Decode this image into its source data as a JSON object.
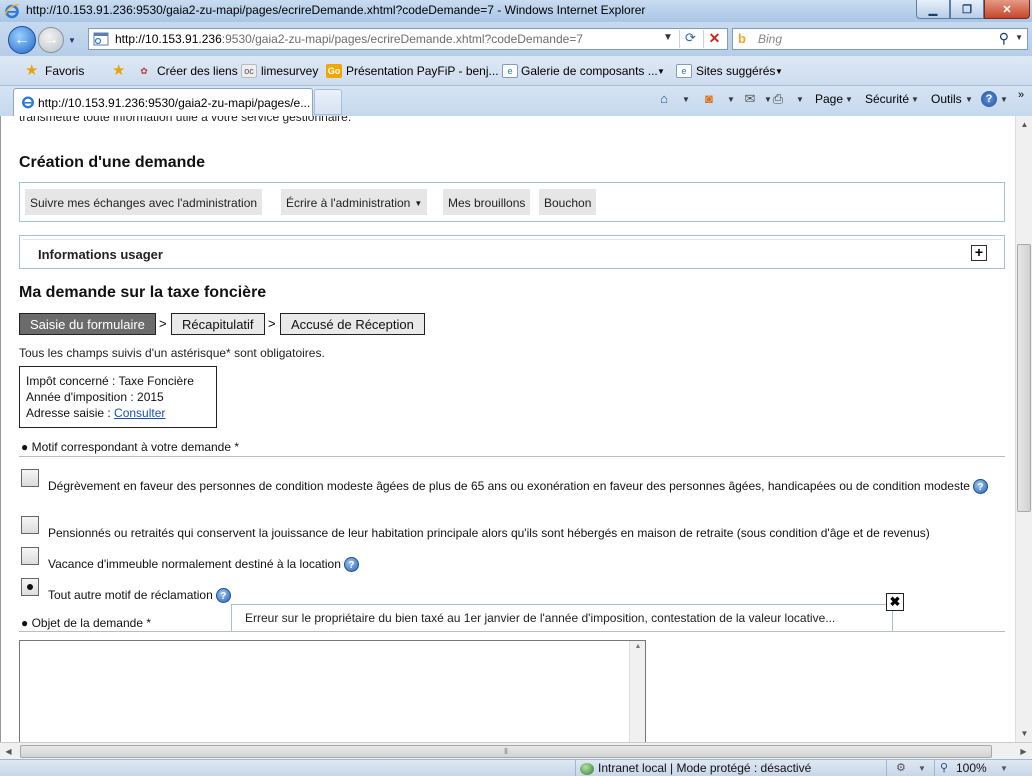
{
  "window": {
    "title": "http://10.153.91.236:9530/gaia2-zu-mapi/pages/ecrireDemande.xhtml?codeDemande=7 - Windows Internet Explorer",
    "controls": [
      "minimize",
      "maximize",
      "close"
    ]
  },
  "address": {
    "url_host": "http://10.153.91.236",
    "url_rest": ":9530/gaia2-zu-mapi/pages/ecrireDemande.xhtml?codeDemande=7",
    "search_placeholder": "Bing"
  },
  "favorites": {
    "label": "Favoris",
    "links": [
      {
        "label": "Créer des liens",
        "icon": "link-icon"
      },
      {
        "label": "limesurvey",
        "icon": "limesurvey-icon"
      },
      {
        "label": "Présentation PayFiP - benj...",
        "icon": "payfip-icon"
      },
      {
        "label": "Galerie de composants ...",
        "icon": "gallery-icon"
      },
      {
        "label": "Sites suggérés",
        "icon": "suggested-sites-icon"
      }
    ]
  },
  "tab": {
    "label": "http://10.153.91.236:9530/gaia2-zu-mapi/pages/e..."
  },
  "commandbar": {
    "page": "Page",
    "security": "Sécurité",
    "tools": "Outils"
  },
  "page": {
    "cut_text": "transmettre toute information utile à votre service gestionnaire.",
    "title": "Création d'une demande",
    "menu": {
      "follow": "Suivre mes échanges avec l'administration",
      "write": "Écrire à l'administration",
      "drafts": "Mes brouillons",
      "stub": "Bouchon"
    },
    "info_panel": {
      "label": "Informations usager",
      "toggle": "+"
    },
    "section_title": "Ma demande sur la taxe foncière",
    "steps": [
      "Saisie du formulaire",
      "Récapitulatif",
      "Accusé de Réception"
    ],
    "step_separator": ">",
    "required_note": "Tous les champs suivis d'un astérisque* sont obligatoires.",
    "summary": {
      "tax": "Impôt concerné : Taxe Foncière",
      "year": "Année d'imposition : 2015",
      "address_label": "Adresse saisie :",
      "address_link": "Consulter"
    },
    "reason": {
      "label": "● Motif correspondant à votre demande *",
      "options": [
        {
          "label": "Dégrèvement en faveur des personnes de condition modeste âgées de plus de 65 ans ou exonération en faveur des personnes âgées, handicapées ou de condition modeste",
          "checked": false,
          "help": true
        },
        {
          "label": "Pensionnés ou retraités qui conservent la jouissance de leur habitation principale alors qu'ils sont hébergés en maison de retraite (sous condition d'âge et de revenus)",
          "checked": false,
          "help": false
        },
        {
          "label": "Vacance d'immeuble normalement destiné à la location",
          "checked": false,
          "help": true
        },
        {
          "label": "Tout autre motif de réclamation",
          "checked": true,
          "help": true
        }
      ]
    },
    "tooltip": "Erreur sur le propriétaire du bien taxé au 1er janvier de l'année d'imposition, contestation de la valeur locative...",
    "tooltip_close": "✖",
    "object": {
      "label": "● Objet de la demande *",
      "value": ""
    }
  },
  "statusbar": {
    "zone": "Intranet local | Mode protégé : désactivé",
    "zoom": "100%"
  }
}
